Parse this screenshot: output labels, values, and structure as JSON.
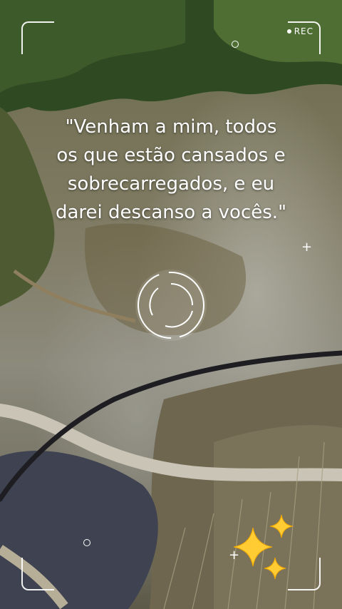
{
  "quote": {
    "text": "\"Venham a mim, todos\nos que estão cansados e\nsobrecarregados, e eu\ndarei descanso a vocês.\""
  },
  "rec_label": "REC",
  "icons": {
    "focus": "focus-ring-icon",
    "sparkles": "sparkles-icon",
    "plus": "plus-icon",
    "dot": "small-circle-icon"
  }
}
